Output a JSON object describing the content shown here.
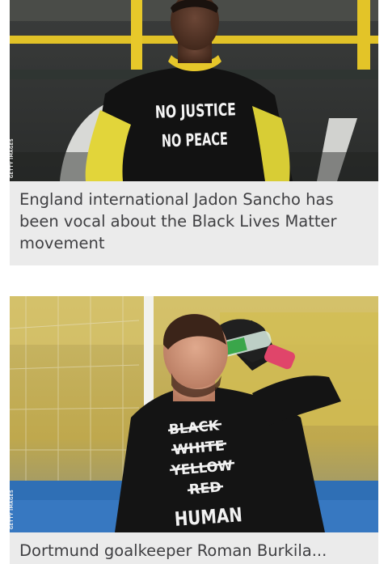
{
  "articles": [
    {
      "image": {
        "shirt_lines": [
          "NO JUSTICE",
          "NO PEACE"
        ],
        "credit": "GETTY IMAGES"
      },
      "caption": "England international Jadon Sancho has been vocal about the Black Lives Matter movement"
    },
    {
      "image": {
        "shirt_lines": [
          "BLACK",
          "WHITE",
          "YELLOW",
          "RED",
          "HUMAN"
        ],
        "credit": "GETTY IMAGES"
      },
      "caption": "Dortmund goalkeeper Roman Burkila..."
    }
  ]
}
